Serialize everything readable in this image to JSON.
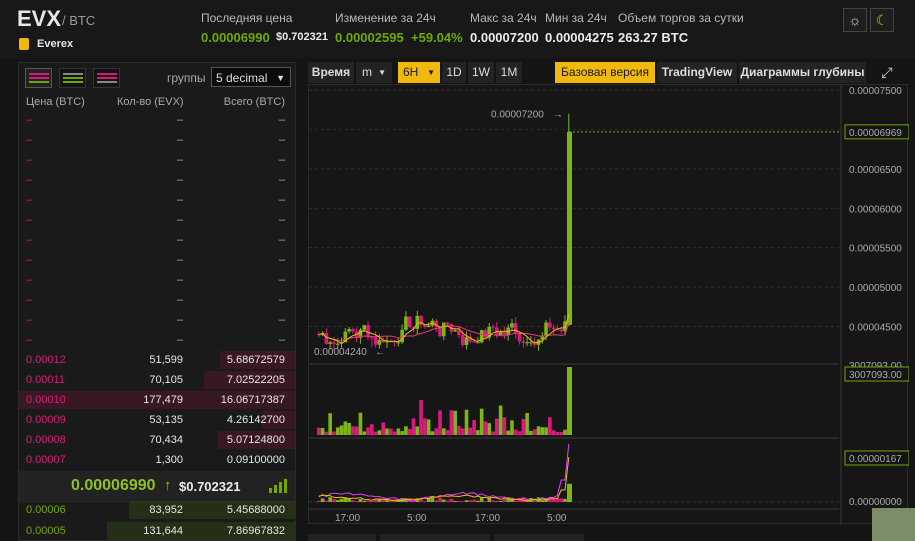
{
  "pair": {
    "symbol": "EVX",
    "quote": "/ BTC",
    "name": "Everex"
  },
  "stats": {
    "last_price_label": "Последняя цена",
    "last_price": "0.00006990",
    "last_price_btc": "$0.702321",
    "change_label": "Изменение за 24ч",
    "change_value": "0.00002595",
    "change_pct": "+59.04%",
    "high_label": "Макс за 24ч",
    "high_value": "0.00007200",
    "low_label": "Мин за 24ч",
    "low_value": "0.00004275",
    "volume_label": "Объем торгов за сутки",
    "volume_value": "263.27 BTC"
  },
  "theme": {
    "light_icon": "sun-icon",
    "dark_icon": "moon-icon"
  },
  "orderbook": {
    "groups_label": "группы",
    "groups_value": "5 decimal",
    "headers": {
      "price": "Цена (BTC)",
      "qty": "Кол-во (EVX)",
      "total": "Всего (BTC)"
    },
    "empty_asks": [
      "–",
      "–",
      "–",
      "–",
      "–",
      "–",
      "–",
      "–",
      "–",
      "–",
      "–",
      "–"
    ],
    "asks": [
      {
        "price": "0.00012",
        "qty": "51,599",
        "total": "5.68672579",
        "depth": 0.27
      },
      {
        "price": "0.00011",
        "qty": "70,105",
        "total": "7.02522205",
        "depth": 0.33
      },
      {
        "price": "0.00010",
        "qty": "177,479",
        "total": "16.06717387",
        "depth": 1.0
      },
      {
        "price": "0.00009",
        "qty": "53,135",
        "total": "4.26142700",
        "depth": 0.12
      },
      {
        "price": "0.00008",
        "qty": "70,434",
        "total": "5.07124800",
        "depth": 0.28
      },
      {
        "price": "0.00007",
        "qty": "1,300",
        "total": "0.09100000",
        "depth": 0.0
      }
    ],
    "current_price": "0.00006990",
    "current_arrow": "↑",
    "current_usd": "$0.702321",
    "bids": [
      {
        "price": "0.00006",
        "qty": "83,952",
        "total": "5.45688000",
        "depth": 0.6
      },
      {
        "price": "0.00005",
        "qty": "131,644",
        "total": "7.86967832",
        "depth": 0.68
      }
    ]
  },
  "toolbar": {
    "time_label": "Время",
    "interval_m": "m",
    "interval_6h": "6H",
    "interval_1d": "1D",
    "interval_1w": "1W",
    "interval_1m": "1M",
    "basic_label": "Базовая версия",
    "tradingview_label": "TradingView",
    "depth_label": "Диаграммы глубины"
  },
  "chart_data": {
    "type": "candlestick",
    "price_axis_ticks": [
      "0.00007500",
      "0.00007000",
      "0.00006500",
      "0.00006000",
      "0.00005500",
      "0.00005000",
      "0.00004500"
    ],
    "price_ylim": [
      4.05e-05,
      7.5e-05
    ],
    "current_price_tag": "0.00006969",
    "current_price_value": 6.969e-05,
    "high_annotation": "0.00007200",
    "high_value": 7.2e-05,
    "low_annotation": "0.00004240",
    "low_value": 4.24e-05,
    "volume_axis_top": "3007093.00",
    "volume_tag": "3007093.00",
    "indicator_tag": "0.00000167",
    "indicator_zero": "0.00000000",
    "x_ticks": [
      "17:00",
      "5:00",
      "17:00",
      "5:00"
    ],
    "up_color": "#7cb518",
    "down_color": "#d81b7a"
  }
}
